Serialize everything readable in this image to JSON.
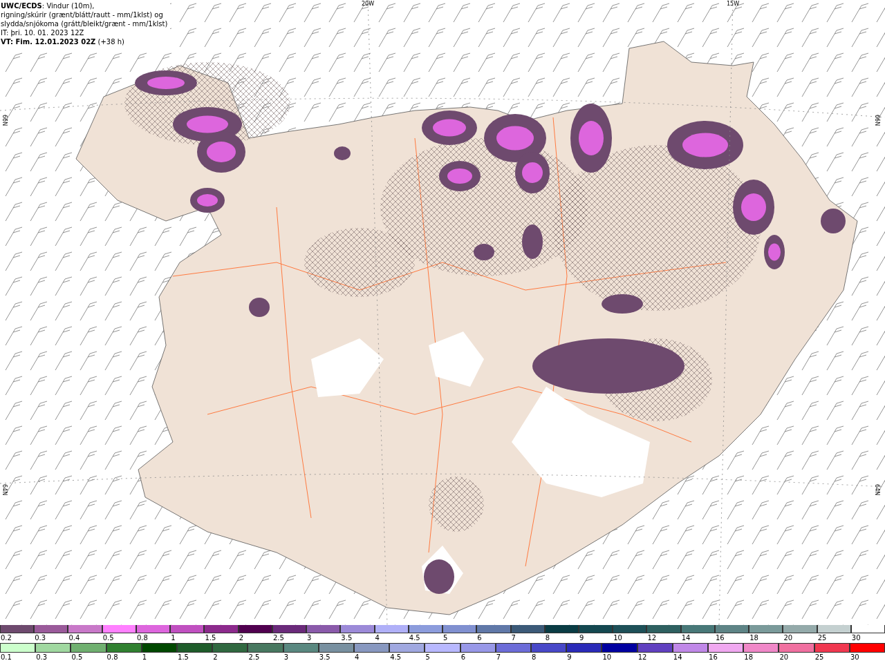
{
  "header": {
    "lines": [
      "**UWC/ECDS**: Vindur (10m),",
      "rigning/skúrir (grænt/blátt/rautt - mm/1klst) og",
      "slydda/snjókoma (grátt/bleikt/grænt - mm/1klst)",
      "IT: þri. 10. 01. 2023 12Z",
      "**VT: Fim. 12.01.2023 02Z** (+38 h)"
    ]
  },
  "map": {
    "longitude_labels": [
      "20W",
      "15W"
    ],
    "latitude_labels_left": [
      "66N",
      "64N"
    ],
    "latitude_labels_right": [
      "66N",
      "64N"
    ]
  },
  "legend_snow": [
    {
      "label": "0.2",
      "color": "#6e4a6e"
    },
    {
      "label": "0.3",
      "color": "#9a5a9a"
    },
    {
      "label": "0.4",
      "color": "#c878c8"
    },
    {
      "label": "0.5",
      "color": "#ff80ff"
    },
    {
      "label": "0.8",
      "color": "#dd66dd"
    },
    {
      "label": "1",
      "color": "#c050c0"
    },
    {
      "label": "1.5",
      "color": "#8c2a8c"
    },
    {
      "label": "2",
      "color": "#50004f"
    },
    {
      "label": "2.5",
      "color": "#6a2a7a"
    },
    {
      "label": "3",
      "color": "#8a5aaa"
    },
    {
      "label": "3.5",
      "color": "#9c8ad8"
    },
    {
      "label": "4",
      "color": "#b0b0f8"
    },
    {
      "label": "4.5",
      "color": "#8c9cdc"
    },
    {
      "label": "5",
      "color": "#8090d0"
    },
    {
      "label": "6",
      "color": "#6078a8"
    },
    {
      "label": "7",
      "color": "#3c5a78"
    },
    {
      "label": "8",
      "color": "#0a3c44"
    },
    {
      "label": "9",
      "color": "#144850"
    },
    {
      "label": "10",
      "color": "#1e5058"
    },
    {
      "label": "12",
      "color": "#2e6060"
    },
    {
      "label": "14",
      "color": "#487878"
    },
    {
      "label": "16",
      "color": "#5e8486"
    },
    {
      "label": "18",
      "color": "#7a9a9a"
    },
    {
      "label": "20",
      "color": "#94aaaa"
    },
    {
      "label": "25",
      "color": "#c4d0d0"
    },
    {
      "label": "30",
      "color": "#ffffff"
    }
  ],
  "legend_rain": [
    {
      "label": "0.1",
      "color": "#ccffcc"
    },
    {
      "label": "0.3",
      "color": "#a0d8a0"
    },
    {
      "label": "0.5",
      "color": "#70b070"
    },
    {
      "label": "0.8",
      "color": "#308030"
    },
    {
      "label": "1",
      "color": "#004800"
    },
    {
      "label": "1.5",
      "color": "#1e5c2a"
    },
    {
      "label": "2",
      "color": "#306840"
    },
    {
      "label": "2.5",
      "color": "#487860"
    },
    {
      "label": "3",
      "color": "#5a8880"
    },
    {
      "label": "3.5",
      "color": "#7890a0"
    },
    {
      "label": "4",
      "color": "#8898c0"
    },
    {
      "label": "4.5",
      "color": "#a0a8e0"
    },
    {
      "label": "5",
      "color": "#b8b8ff"
    },
    {
      "label": "6",
      "color": "#9898e8"
    },
    {
      "label": "7",
      "color": "#6c6cd8"
    },
    {
      "label": "8",
      "color": "#4848c8"
    },
    {
      "label": "9",
      "color": "#2a2ab8"
    },
    {
      "label": "10",
      "color": "#0000a0"
    },
    {
      "label": "12",
      "color": "#6040c0"
    },
    {
      "label": "14",
      "color": "#c088e8"
    },
    {
      "label": "16",
      "color": "#f0a8f0"
    },
    {
      "label": "18",
      "color": "#f088c8"
    },
    {
      "label": "20",
      "color": "#f070a0"
    },
    {
      "label": "25",
      "color": "#f03850"
    },
    {
      "label": "30",
      "color": "#ff0000"
    }
  ]
}
